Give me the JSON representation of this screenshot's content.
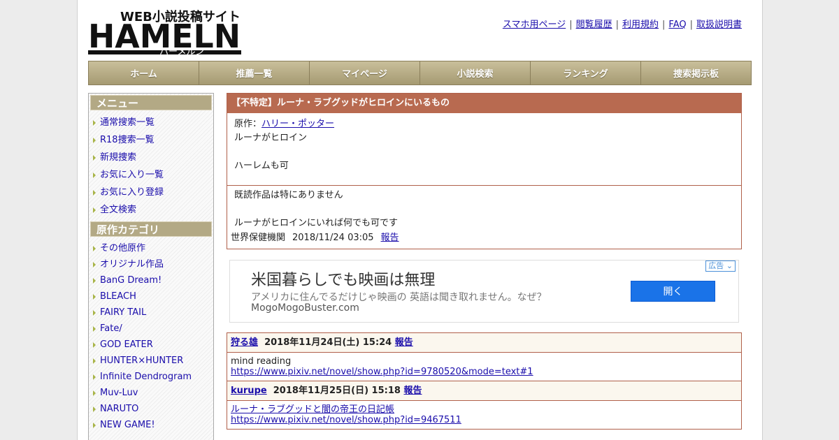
{
  "header": {
    "logo_text": "HAMELN",
    "logo_tagline": "WEB小説投稿サイト",
    "logo_kana": "ハーメルン",
    "links": [
      "スマホ用ページ",
      "閲覧履歴",
      "利用規約",
      "FAQ",
      "取扱説明書"
    ],
    "separator": "|"
  },
  "nav": [
    "ホーム",
    "推薦一覧",
    "マイページ",
    "小説検索",
    "ランキング",
    "捜索掲示板"
  ],
  "sidebar": {
    "menu_title": "メニュー",
    "menu_items": [
      "通常搜索一覧",
      "R18捜索一覧",
      "新規捜索",
      "お気に入り一覧",
      "お気に入り登録",
      "全文検索"
    ],
    "category_title": "原作カテゴリ",
    "category_items": [
      "その他原作",
      "オリジナル作品",
      "BanG Dream!",
      "BLEACH",
      "FAIRY TAIL",
      "Fate/",
      "GOD EATER",
      "HUNTER×HUNTER",
      "Infinite Dendrogram",
      "Muv-Luv",
      "NARUTO",
      "NEW GAME!"
    ]
  },
  "topic": {
    "title": "【不特定】ルーナ・ラブグッドがヒロインにいるもの",
    "original_label": "原作：",
    "original_link": "ハリー・ポッター",
    "desc_line1": "ルーナがヒロイン",
    "desc_line2": "ハーレムも可",
    "read_line1": "既読作品は特にありません",
    "read_line2": "ルーナがヒロインにいれば何でも可です",
    "author": "世界保健機関",
    "date": "2018/11/24 03:05",
    "report": "報告"
  },
  "ad": {
    "badge": "広告",
    "headline": "米国暮らしでも映画は無理",
    "description": "アメリカに住んでるだけじゃ映画の 英語は聞き取れません。なぜ？",
    "domain": "MogoMogoBuster.com",
    "button": "開く"
  },
  "comments": [
    {
      "user": "狩る雄",
      "date": "2018年11月24日(土) 15:24",
      "report": "報告",
      "line1": "mind reading",
      "line2": "https://www.pixiv.net/novel/show.php?id=9780520&mode=text#1"
    },
    {
      "user": "kurupe",
      "date": "2018年11月25日(日) 15:18",
      "report": "報告",
      "line1": "ルーナ・ラブグッドと闇の帝王の日記帳",
      "line2": "https://www.pixiv.net/novel/show.php?id=9467511"
    }
  ]
}
